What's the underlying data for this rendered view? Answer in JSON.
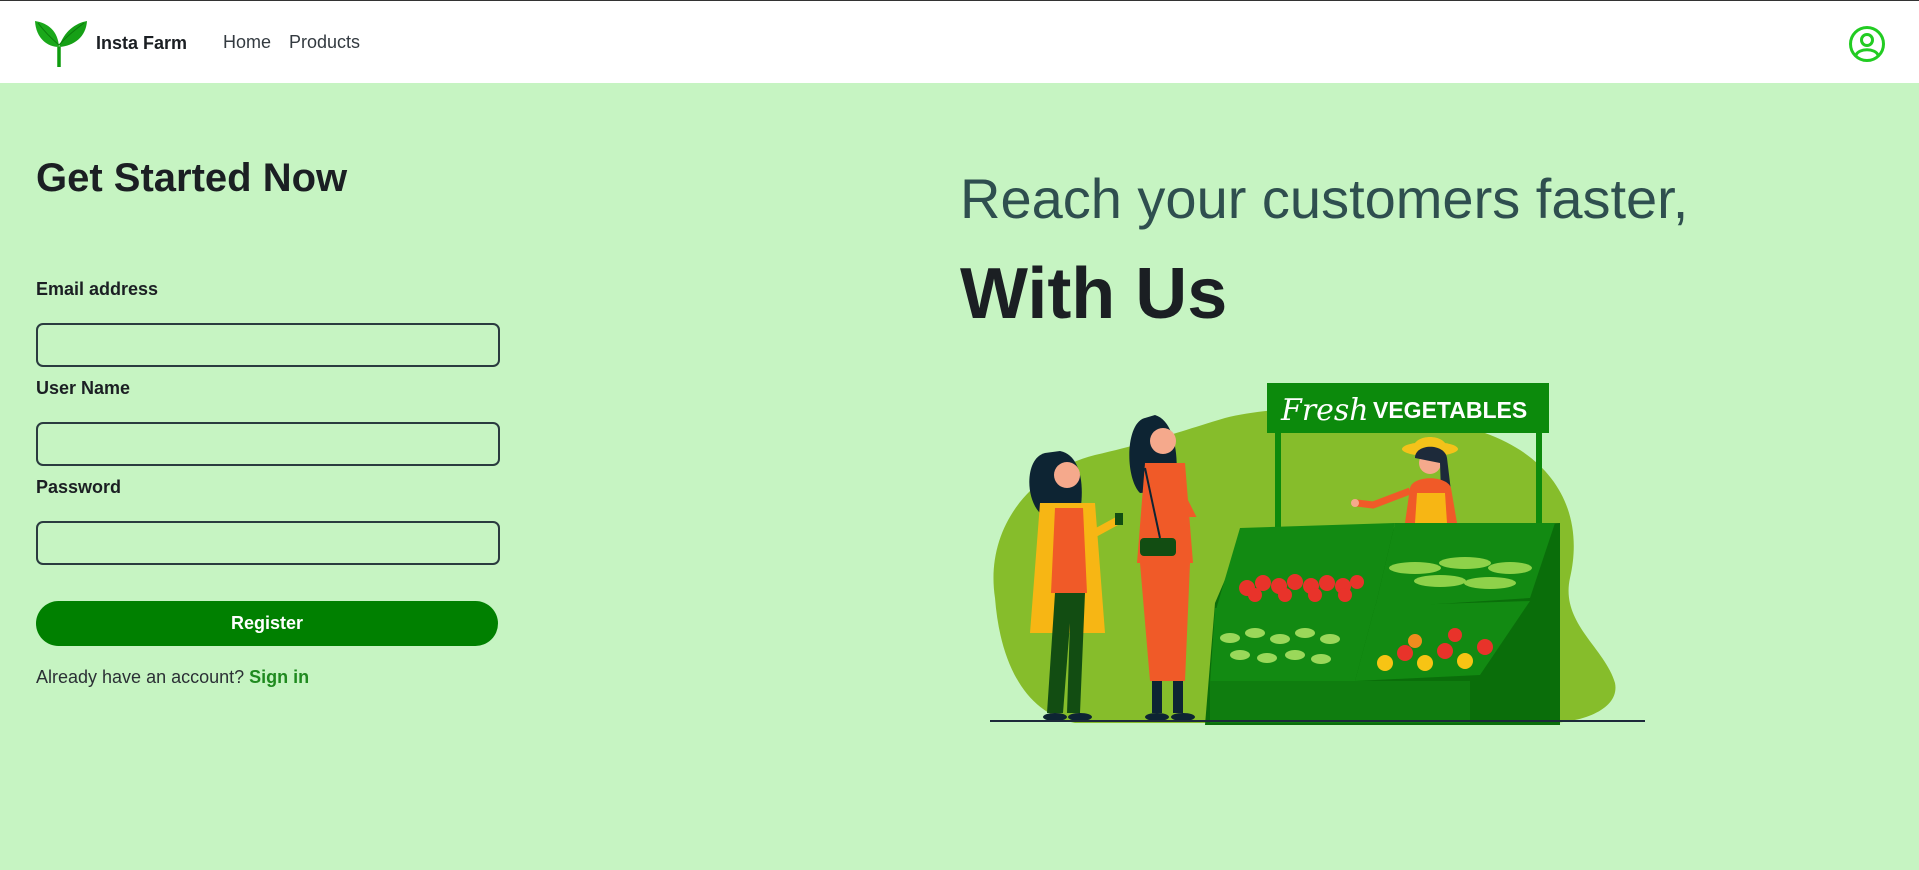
{
  "colors": {
    "nav_bg": "#ffffff",
    "main_bg": "#c6f4c2",
    "accent": "#008000",
    "link": "#1f8a1f",
    "profile_icon": "#22cc22"
  },
  "navbar": {
    "brand": "Insta Farm",
    "logo_icon": "sprout-logo-icon",
    "links": [
      "Home",
      "Products"
    ],
    "profile_icon": "user-circle-icon"
  },
  "form": {
    "title": "Get Started Now",
    "email_label": "Email address",
    "email_value": "",
    "username_label": "User Name",
    "username_value": "",
    "password_label": "Password",
    "password_value": "",
    "submit_label": "Register",
    "signin_prompt": "Already have an account?",
    "signin_link": "Sign in"
  },
  "hero": {
    "line1": "Reach your customers faster,",
    "line2": "With Us",
    "sign_script": "Fresh",
    "sign_text": "VEGETABLES"
  }
}
